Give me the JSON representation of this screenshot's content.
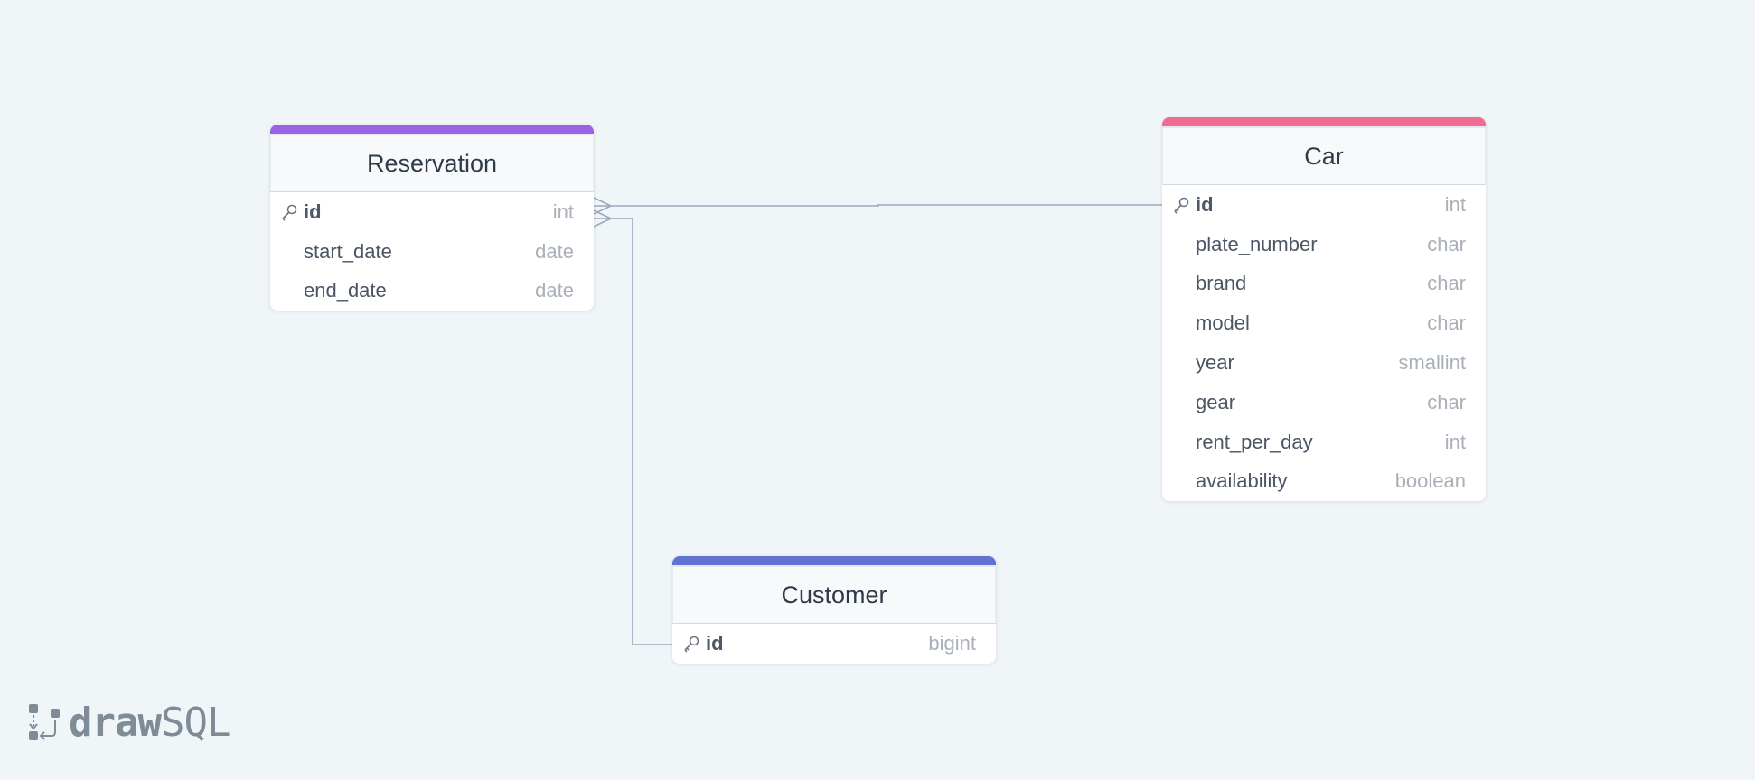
{
  "tables": {
    "reservation": {
      "title": "Reservation",
      "accent": "#9b63e6",
      "fields": [
        {
          "name": "id",
          "type": "int",
          "primary_key": true
        },
        {
          "name": "start_date",
          "type": "date",
          "primary_key": false
        },
        {
          "name": "end_date",
          "type": "date",
          "primary_key": false
        }
      ]
    },
    "car": {
      "title": "Car",
      "accent": "#f06b92",
      "fields": [
        {
          "name": "id",
          "type": "int",
          "primary_key": true
        },
        {
          "name": "plate_number",
          "type": "char",
          "primary_key": false
        },
        {
          "name": "brand",
          "type": "char",
          "primary_key": false
        },
        {
          "name": "model",
          "type": "char",
          "primary_key": false
        },
        {
          "name": "year",
          "type": "smallint",
          "primary_key": false
        },
        {
          "name": "gear",
          "type": "char",
          "primary_key": false
        },
        {
          "name": "rent_per_day",
          "type": "int",
          "primary_key": false
        },
        {
          "name": "availability",
          "type": "boolean",
          "primary_key": false
        }
      ]
    },
    "customer": {
      "title": "Customer",
      "accent": "#6272d2",
      "fields": [
        {
          "name": "id",
          "type": "bigint",
          "primary_key": true
        }
      ]
    }
  },
  "relations": [
    {
      "from": "reservation",
      "to": "car",
      "cardinality": "many-to-one"
    },
    {
      "from": "reservation",
      "to": "customer",
      "cardinality": "many-to-one"
    }
  ],
  "connector_color": "#9aaabb",
  "logo": {
    "bold": "draw",
    "light": "SQL",
    "icon": "drawsql-logo-icon"
  }
}
